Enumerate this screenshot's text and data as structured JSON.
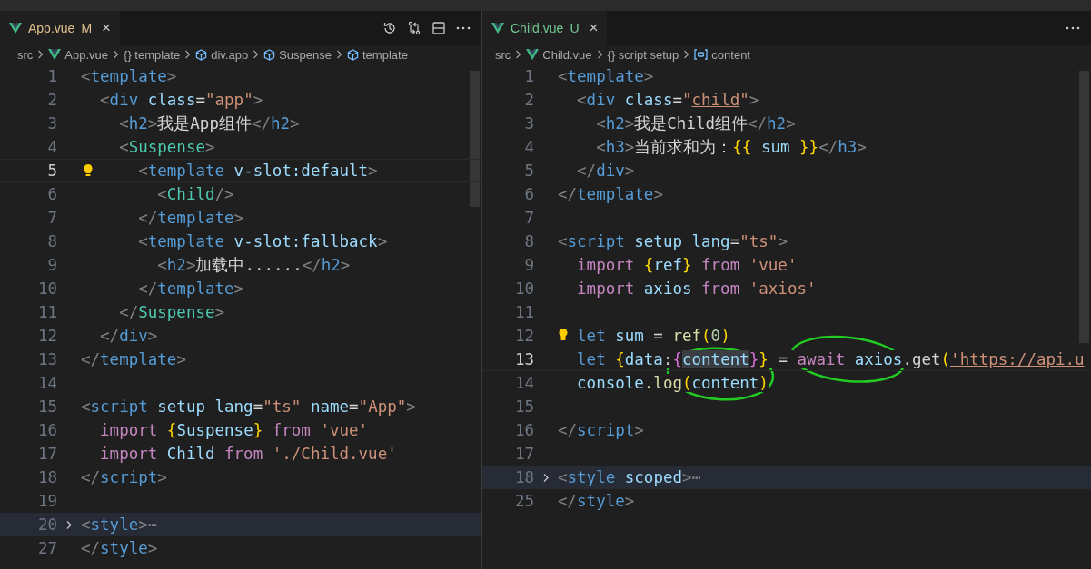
{
  "panes": [
    {
      "tab": {
        "label": "App.vue",
        "status": "M",
        "color": "#e2c08d",
        "close": "×",
        "selected": true
      },
      "toolbar": [
        {
          "kind": "history"
        },
        {
          "kind": "compare"
        },
        {
          "kind": "split"
        },
        {
          "kind": "more"
        }
      ],
      "breadcrumbs": [
        {
          "kind": "plain",
          "text": "src"
        },
        {
          "kind": "vue",
          "text": "App.vue"
        },
        {
          "kind": "plain",
          "text": "{} template"
        },
        {
          "kind": "element",
          "text": "div.app"
        },
        {
          "kind": "element",
          "text": "Suspense"
        },
        {
          "kind": "element",
          "text": "template"
        }
      ],
      "lines": [
        {
          "number": "1",
          "kind": "plain",
          "current": false,
          "tokens": [
            {
              "kind": "p",
              "text": "<"
            },
            {
              "kind": "tag",
              "text": "template"
            },
            {
              "kind": "p",
              "text": ">"
            }
          ]
        },
        {
          "number": "2",
          "kind": "plain",
          "current": false,
          "tokens": [
            {
              "kind": "p",
              "text": "  <"
            },
            {
              "kind": "tag",
              "text": "div"
            },
            {
              "kind": "attr",
              "text": " class"
            },
            {
              "kind": "txt",
              "text": "="
            },
            {
              "kind": "str",
              "text": "\"app\""
            },
            {
              "kind": "p",
              "text": ">"
            }
          ]
        },
        {
          "number": "3",
          "kind": "plain",
          "current": false,
          "tokens": [
            {
              "kind": "p",
              "text": "    <"
            },
            {
              "kind": "tag",
              "text": "h2"
            },
            {
              "kind": "p",
              "text": ">"
            },
            {
              "kind": "txt",
              "text": "我是App组件"
            },
            {
              "kind": "p",
              "text": "</"
            },
            {
              "kind": "tag",
              "text": "h2"
            },
            {
              "kind": "p",
              "text": ">"
            }
          ]
        },
        {
          "number": "4",
          "kind": "plain",
          "current": false,
          "tokens": [
            {
              "kind": "p",
              "text": "    <"
            },
            {
              "kind": "comp",
              "text": "Suspense"
            },
            {
              "kind": "p",
              "text": ">"
            }
          ]
        },
        {
          "number": "5",
          "kind": "bulb",
          "current": true,
          "tokens": [
            {
              "kind": "p",
              "text": "      <"
            },
            {
              "kind": "tag",
              "text": "template"
            },
            {
              "kind": "attr",
              "text": " v-slot:default"
            },
            {
              "kind": "p",
              "text": ">"
            }
          ]
        },
        {
          "number": "6",
          "kind": "plain",
          "current": false,
          "tokens": [
            {
              "kind": "p",
              "text": "        <"
            },
            {
              "kind": "comp",
              "text": "Child"
            },
            {
              "kind": "p",
              "text": "/>"
            }
          ]
        },
        {
          "number": "7",
          "kind": "plain",
          "current": false,
          "tokens": [
            {
              "kind": "p",
              "text": "      </"
            },
            {
              "kind": "tag",
              "text": "template"
            },
            {
              "kind": "p",
              "text": ">"
            }
          ]
        },
        {
          "number": "8",
          "kind": "plain",
          "current": false,
          "tokens": [
            {
              "kind": "p",
              "text": "      <"
            },
            {
              "kind": "tag",
              "text": "template"
            },
            {
              "kind": "attr",
              "text": " v-slot:fallback"
            },
            {
              "kind": "p",
              "text": ">"
            }
          ]
        },
        {
          "number": "9",
          "kind": "plain",
          "current": false,
          "tokens": [
            {
              "kind": "p",
              "text": "        <"
            },
            {
              "kind": "tag",
              "text": "h2"
            },
            {
              "kind": "p",
              "text": ">"
            },
            {
              "kind": "txt",
              "text": "加载中......"
            },
            {
              "kind": "p",
              "text": "</"
            },
            {
              "kind": "tag",
              "text": "h2"
            },
            {
              "kind": "p",
              "text": ">"
            }
          ]
        },
        {
          "number": "10",
          "kind": "plain",
          "current": false,
          "tokens": [
            {
              "kind": "p",
              "text": "      </"
            },
            {
              "kind": "tag",
              "text": "template"
            },
            {
              "kind": "p",
              "text": ">"
            }
          ]
        },
        {
          "number": "11",
          "kind": "plain",
          "current": false,
          "tokens": [
            {
              "kind": "p",
              "text": "    </"
            },
            {
              "kind": "comp",
              "text": "Suspense"
            },
            {
              "kind": "p",
              "text": ">"
            }
          ]
        },
        {
          "number": "12",
          "kind": "plain",
          "current": false,
          "tokens": [
            {
              "kind": "p",
              "text": "  </"
            },
            {
              "kind": "tag",
              "text": "div"
            },
            {
              "kind": "p",
              "text": ">"
            }
          ]
        },
        {
          "number": "13",
          "kind": "plain",
          "current": false,
          "tokens": [
            {
              "kind": "p",
              "text": "</"
            },
            {
              "kind": "tag",
              "text": "template"
            },
            {
              "kind": "p",
              "text": ">"
            }
          ]
        },
        {
          "number": "14",
          "kind": "plain",
          "current": false
        },
        {
          "number": "15",
          "kind": "plain",
          "current": false,
          "tokens": [
            {
              "kind": "p",
              "text": "<"
            },
            {
              "kind": "tag",
              "text": "script"
            },
            {
              "kind": "attr",
              "text": " setup lang"
            },
            {
              "kind": "txt",
              "text": "="
            },
            {
              "kind": "str",
              "text": "\"ts\""
            },
            {
              "kind": "attr",
              "text": " name"
            },
            {
              "kind": "txt",
              "text": "="
            },
            {
              "kind": "str",
              "text": "\"App\""
            },
            {
              "kind": "p",
              "text": ">"
            }
          ]
        },
        {
          "number": "16",
          "kind": "plain",
          "current": false,
          "tokens": [
            {
              "kind": "ctl",
              "text": "  import "
            },
            {
              "kind": "b1",
              "text": "{"
            },
            {
              "kind": "var",
              "text": "Suspense"
            },
            {
              "kind": "b1",
              "text": "}"
            },
            {
              "kind": "ctl",
              "text": " from "
            },
            {
              "kind": "str",
              "text": "'vue'"
            }
          ]
        },
        {
          "number": "17",
          "kind": "plain",
          "current": false,
          "tokens": [
            {
              "kind": "ctl",
              "text": "  import "
            },
            {
              "kind": "var",
              "text": "Child"
            },
            {
              "kind": "ctl",
              "text": " from "
            },
            {
              "kind": "str",
              "text": "'./Child.vue'"
            }
          ]
        },
        {
          "number": "18",
          "kind": "plain",
          "current": false,
          "tokens": [
            {
              "kind": "p",
              "text": "</"
            },
            {
              "kind": "tag",
              "text": "script"
            },
            {
              "kind": "p",
              "text": ">"
            }
          ]
        },
        {
          "number": "19",
          "kind": "plain",
          "current": false
        },
        {
          "number": "20",
          "kind": "folded",
          "current": false,
          "tokens": [
            {
              "kind": "p",
              "text": "<"
            },
            {
              "kind": "tag",
              "text": "style"
            },
            {
              "kind": "p",
              "text": ">⋯"
            }
          ]
        },
        {
          "number": "27",
          "kind": "plain",
          "current": false,
          "tokens": [
            {
              "kind": "p",
              "text": "</"
            },
            {
              "kind": "tag",
              "text": "style"
            },
            {
              "kind": "p",
              "text": ">"
            }
          ]
        }
      ]
    },
    {
      "tab": {
        "label": "Child.vue",
        "status": "U",
        "color": "#73c991",
        "close": "×",
        "selected": true
      },
      "toolbar": [
        {
          "kind": "more"
        }
      ],
      "breadcrumbs": [
        {
          "kind": "plain",
          "text": "src"
        },
        {
          "kind": "vue",
          "text": "Child.vue"
        },
        {
          "kind": "plain",
          "text": "{} script setup"
        },
        {
          "kind": "variable",
          "text": "content"
        }
      ],
      "lines": [
        {
          "number": "1",
          "kind": "plain",
          "current": false,
          "tokens": [
            {
              "kind": "p",
              "text": "<"
            },
            {
              "kind": "tag",
              "text": "template"
            },
            {
              "kind": "p",
              "text": ">"
            }
          ]
        },
        {
          "number": "2",
          "kind": "plain",
          "current": false,
          "tokens": [
            {
              "kind": "p",
              "text": "  <"
            },
            {
              "kind": "tag",
              "text": "div"
            },
            {
              "kind": "attr",
              "text": " class"
            },
            {
              "kind": "txt",
              "text": "="
            },
            {
              "kind": "str",
              "text": "\""
            },
            {
              "kind": "url",
              "text": "child"
            },
            {
              "kind": "str",
              "text": "\""
            },
            {
              "kind": "p",
              "text": ">"
            }
          ]
        },
        {
          "number": "3",
          "kind": "plain",
          "current": false,
          "tokens": [
            {
              "kind": "p",
              "text": "    <"
            },
            {
              "kind": "tag",
              "text": "h2"
            },
            {
              "kind": "p",
              "text": ">"
            },
            {
              "kind": "txt",
              "text": "我是Child组件"
            },
            {
              "kind": "p",
              "text": "</"
            },
            {
              "kind": "tag",
              "text": "h2"
            },
            {
              "kind": "p",
              "text": ">"
            }
          ]
        },
        {
          "number": "4",
          "kind": "plain",
          "current": false,
          "tokens": [
            {
              "kind": "p",
              "text": "    <"
            },
            {
              "kind": "tag",
              "text": "h3"
            },
            {
              "kind": "p",
              "text": ">"
            },
            {
              "kind": "txt",
              "text": "当前求和为："
            },
            {
              "kind": "b1",
              "text": "{{"
            },
            {
              "kind": "var",
              "text": " sum "
            },
            {
              "kind": "b1",
              "text": "}}"
            },
            {
              "kind": "p",
              "text": "</"
            },
            {
              "kind": "tag",
              "text": "h3"
            },
            {
              "kind": "p",
              "text": ">"
            }
          ]
        },
        {
          "number": "5",
          "kind": "plain",
          "current": false,
          "tokens": [
            {
              "kind": "p",
              "text": "  </"
            },
            {
              "kind": "tag",
              "text": "div"
            },
            {
              "kind": "p",
              "text": ">"
            }
          ]
        },
        {
          "number": "6",
          "kind": "plain",
          "current": false,
          "tokens": [
            {
              "kind": "p",
              "text": "</"
            },
            {
              "kind": "tag",
              "text": "template"
            },
            {
              "kind": "p",
              "text": ">"
            }
          ]
        },
        {
          "number": "7",
          "kind": "plain",
          "current": false
        },
        {
          "number": "8",
          "kind": "plain",
          "current": false,
          "tokens": [
            {
              "kind": "p",
              "text": "<"
            },
            {
              "kind": "tag",
              "text": "script"
            },
            {
              "kind": "attr",
              "text": " setup lang"
            },
            {
              "kind": "txt",
              "text": "="
            },
            {
              "kind": "str",
              "text": "\"ts\""
            },
            {
              "kind": "p",
              "text": ">"
            }
          ]
        },
        {
          "number": "9",
          "kind": "plain",
          "current": false,
          "tokens": [
            {
              "kind": "ctl",
              "text": "  import "
            },
            {
              "kind": "b1",
              "text": "{"
            },
            {
              "kind": "var",
              "text": "ref"
            },
            {
              "kind": "b1",
              "text": "}"
            },
            {
              "kind": "ctl",
              "text": " from "
            },
            {
              "kind": "str",
              "text": "'vue'"
            }
          ]
        },
        {
          "number": "10",
          "kind": "plain",
          "current": false,
          "tokens": [
            {
              "kind": "ctl",
              "text": "  import "
            },
            {
              "kind": "var",
              "text": "axios"
            },
            {
              "kind": "ctl",
              "text": " from "
            },
            {
              "kind": "str",
              "text": "'axios'"
            }
          ]
        },
        {
          "number": "11",
          "kind": "plain",
          "current": false
        },
        {
          "number": "12",
          "kind": "bulb",
          "current": false,
          "tokens": [
            {
              "kind": "kw",
              "text": "  let "
            },
            {
              "kind": "var",
              "text": "sum"
            },
            {
              "kind": "txt",
              "text": " = "
            },
            {
              "kind": "fn",
              "text": "ref"
            },
            {
              "kind": "b1",
              "text": "("
            },
            {
              "kind": "num",
              "text": "0"
            },
            {
              "kind": "b1",
              "text": ")"
            }
          ]
        },
        {
          "number": "13",
          "kind": "plain",
          "current": true,
          "tokens": [
            {
              "kind": "kw",
              "text": "  let "
            },
            {
              "kind": "b1",
              "text": "{"
            },
            {
              "kind": "var",
              "text": "data"
            },
            {
              "kind": "txt",
              "text": ":"
            },
            {
              "kind": "b2",
              "text": "{"
            },
            {
              "kind": "hl",
              "text": "content"
            },
            {
              "kind": "b2",
              "text": "}"
            },
            {
              "kind": "b1",
              "text": "}"
            },
            {
              "kind": "txt",
              "text": " = "
            },
            {
              "kind": "ctl",
              "text": "await "
            },
            {
              "kind": "var",
              "text": "axios"
            },
            {
              "kind": "txt",
              "text": ".get"
            },
            {
              "kind": "b1",
              "text": "("
            },
            {
              "kind": "url",
              "text": "'https://api.u"
            }
          ]
        },
        {
          "number": "14",
          "kind": "plain",
          "current": false,
          "tokens": [
            {
              "kind": "var",
              "text": "  console"
            },
            {
              "kind": "fn",
              "text": ".log"
            },
            {
              "kind": "b1",
              "text": "("
            },
            {
              "kind": "var",
              "text": "content"
            },
            {
              "kind": "b1",
              "text": ")"
            }
          ]
        },
        {
          "number": "15",
          "kind": "plain",
          "current": false
        },
        {
          "number": "16",
          "kind": "plain",
          "current": false,
          "tokens": [
            {
              "kind": "p",
              "text": "</"
            },
            {
              "kind": "tag",
              "text": "script"
            },
            {
              "kind": "p",
              "text": ">"
            }
          ]
        },
        {
          "number": "17",
          "kind": "plain",
          "current": false
        },
        {
          "number": "18",
          "kind": "folded",
          "current": false,
          "tokens": [
            {
              "kind": "p",
              "text": "<"
            },
            {
              "kind": "tag",
              "text": "style"
            },
            {
              "kind": "attr",
              "text": " scoped"
            },
            {
              "kind": "p",
              "text": ">⋯"
            }
          ]
        },
        {
          "number": "25",
          "kind": "plain",
          "current": false,
          "tokens": [
            {
              "kind": "p",
              "text": "</"
            },
            {
              "kind": "tag",
              "text": "style"
            },
            {
              "kind": "p",
              "text": ">"
            }
          ]
        }
      ]
    }
  ]
}
